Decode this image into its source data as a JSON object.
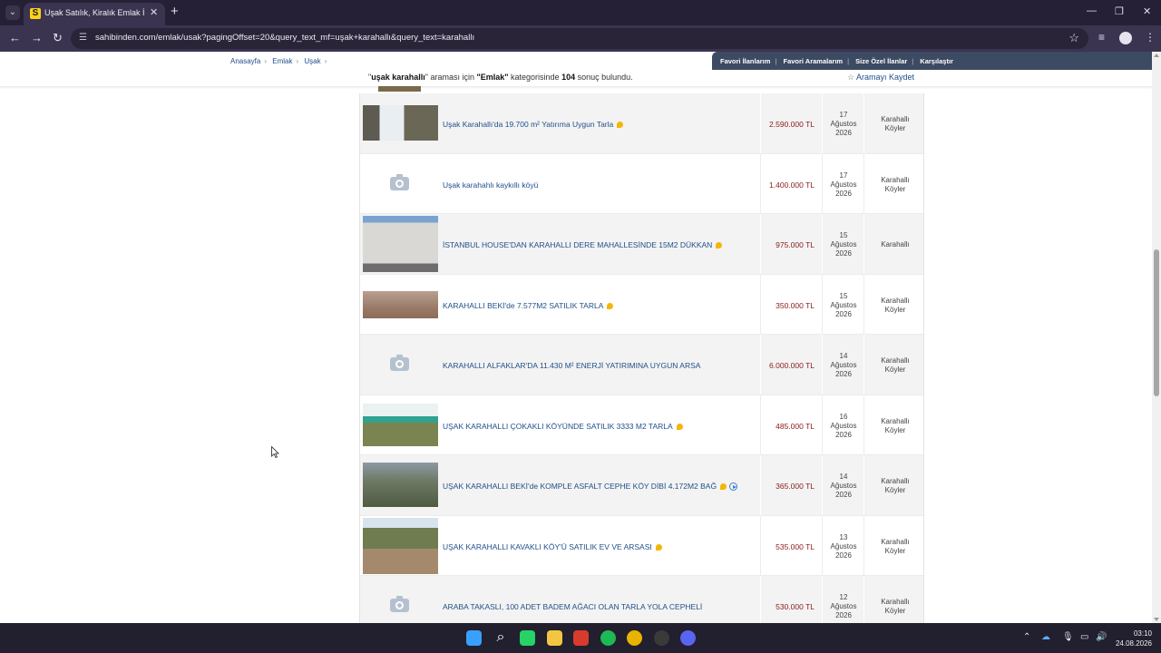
{
  "browser": {
    "tab_title": "Uşak Satılık, Kiralık Emlak İlanları",
    "url": "sahibinden.com/emlak/usak?pagingOffset=20&query_text_mf=uşak+karahallı&query_text=karahallı"
  },
  "breadcrumb": [
    "Anasayfa",
    "Emlak",
    "Uşak"
  ],
  "userbar": {
    "favorites": "Favori İlanlarım",
    "saved_searches": "Favori Aramalarım",
    "for_you": "Size Özel İlanlar",
    "compare": "Karşılaştır"
  },
  "results": {
    "query": "uşak karahallı",
    "text_1": "\"",
    "text_2": "\" araması için ",
    "category": "\"Emlak\"",
    "text_3": " kategorisinde ",
    "count": "104",
    "text_4": " sonuç bulundu.",
    "save_search": "Aramayı Kaydet"
  },
  "listings": [
    {
      "title": "Uşak Karahallı'da 19.700 m² Yatırıma Uygun Tarla",
      "price": "2.590.000 TL",
      "day": "17",
      "month": "Ağustos",
      "year": "2026",
      "loc1": "Karahallı",
      "loc2": "Köyler",
      "badge": true,
      "video": false,
      "image": "screen"
    },
    {
      "title": "Uşak karahahlı kaykıllı köyü",
      "price": "1.400.000 TL",
      "day": "17",
      "month": "Ağustos",
      "year": "2026",
      "loc1": "Karahallı",
      "loc2": "Köyler",
      "badge": false,
      "video": false,
      "image": "none"
    },
    {
      "title": "İSTANBUL HOUSE'DAN KARAHALLI DERE MAHALLESİNDE 15M2 DÜKKAN",
      "price": "975.000 TL",
      "day": "15",
      "month": "Ağustos",
      "year": "2026",
      "loc1": "Karahallı",
      "loc2": "",
      "badge": true,
      "video": false,
      "image": "building"
    },
    {
      "title": "KARAHALLI BEKİ'de 7.577M2 SATILIK TARLA",
      "price": "350.000 TL",
      "day": "15",
      "month": "Ağustos",
      "year": "2026",
      "loc1": "Karahallı",
      "loc2": "Köyler",
      "badge": true,
      "video": false,
      "image": "field"
    },
    {
      "title": "KARAHALLI ALFAKLAR'DA 11.430 M² ENERJİ YATIRIMINA UYGUN ARSA",
      "price": "6.000.000 TL",
      "day": "14",
      "month": "Ağustos",
      "year": "2026",
      "loc1": "Karahallı",
      "loc2": "Köyler",
      "badge": false,
      "video": false,
      "image": "none"
    },
    {
      "title": "UŞAK KARAHALLI ÇOKAKLI KÖYÜNDE SATILIK 3333 M2 TARLA",
      "price": "485.000 TL",
      "day": "16",
      "month": "Ağustos",
      "year": "2026",
      "loc1": "Karahallı",
      "loc2": "Köyler",
      "badge": true,
      "video": false,
      "image": "poster"
    },
    {
      "title": "UŞAK KARAHALLI BEKİ'de KOMPLE ASFALT CEPHE KÖY DİBİ 4.172M2 BAĞ",
      "price": "365.000 TL",
      "day": "14",
      "month": "Ağustos",
      "year": "2026",
      "loc1": "Karahallı",
      "loc2": "Köyler",
      "badge": true,
      "video": true,
      "image": "aerial"
    },
    {
      "title": "UŞAK KARAHALLI KAVAKLI KÖY'Ü SATILIK EV VE ARSASI",
      "price": "535.000 TL",
      "day": "13",
      "month": "Ağustos",
      "year": "2026",
      "loc1": "Karahallı",
      "loc2": "Köyler",
      "badge": true,
      "video": false,
      "image": "village"
    },
    {
      "title": "ARABA TAKASLI, 100 ADET BADEM AĞACI OLAN TARLA YOLA CEPHELİ",
      "price": "530.000 TL",
      "day": "12",
      "month": "Ağustos",
      "year": "2026",
      "loc1": "Karahallı",
      "loc2": "Köyler",
      "badge": false,
      "video": false,
      "image": "none"
    }
  ],
  "taskbar": {
    "apps": [
      "windows-start",
      "search",
      "whatsapp",
      "file-explorer",
      "acrobat",
      "spotify",
      "chrome",
      "obs",
      "discord"
    ],
    "time": "03:10",
    "date": "24.08.2026"
  },
  "colors": {
    "link": "#1f4f8a",
    "price": "#8a1a1a",
    "userbar": "#3c4a62",
    "row_alt": "#f3f3f3"
  }
}
